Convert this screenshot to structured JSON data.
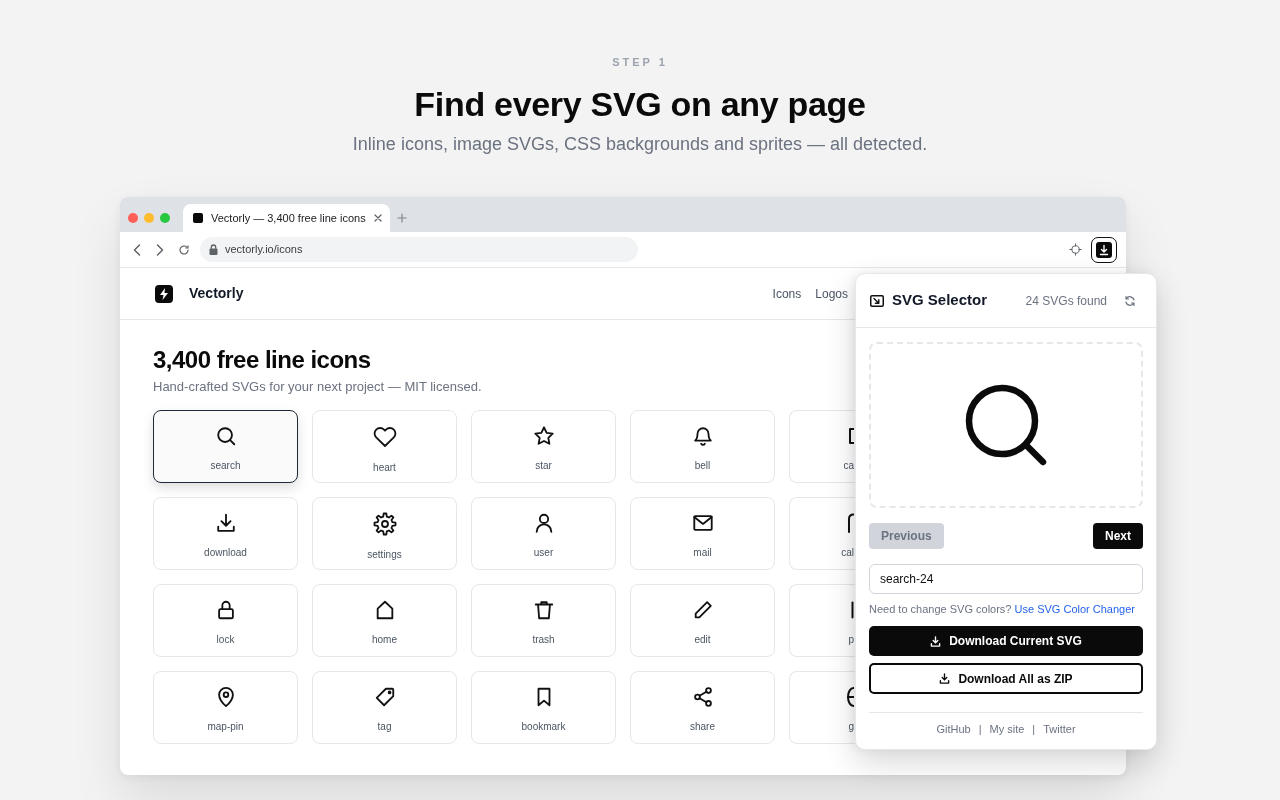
{
  "intro": {
    "step": "STEP 1",
    "title": "Find every SVG on any page",
    "subtitle": "Inline icons, image SVGs, CSS backgrounds and sprites — all detected."
  },
  "browser": {
    "tab": {
      "title": "Vectorly — 3,400 free line icons"
    },
    "address": "vectorly.io/icons",
    "extension_active": true
  },
  "site": {
    "brand": "Vectorly",
    "nav": [
      "Icons",
      "Logos"
    ],
    "title": "3,400 free line icons",
    "subtitle": "Hand-crafted SVGs for your next project — MIT licensed.",
    "icons": [
      {
        "kind": "full",
        "label": "search",
        "selected": true
      },
      {
        "kind": "full",
        "label": "heart",
        "selected": false
      },
      {
        "kind": "full",
        "label": "star",
        "selected": false
      },
      {
        "kind": "full",
        "label": "bell",
        "selected": false
      },
      {
        "kind": "cropped",
        "label": "ca",
        "selected": false
      },
      {
        "kind": "full",
        "label": "download",
        "selected": false
      },
      {
        "kind": "full",
        "label": "settings",
        "selected": false
      },
      {
        "kind": "full",
        "label": "user",
        "selected": false
      },
      {
        "kind": "full",
        "label": "mail",
        "selected": false
      },
      {
        "kind": "cropped",
        "label": "cal",
        "selected": false
      },
      {
        "kind": "full",
        "label": "lock",
        "selected": false
      },
      {
        "kind": "full",
        "label": "home",
        "selected": false
      },
      {
        "kind": "full",
        "label": "trash",
        "selected": false
      },
      {
        "kind": "full",
        "label": "edit",
        "selected": false
      },
      {
        "kind": "cropped",
        "label": "p",
        "selected": false
      },
      {
        "kind": "full",
        "label": "map-pin",
        "selected": false
      },
      {
        "kind": "full",
        "label": "tag",
        "selected": false
      },
      {
        "kind": "full",
        "label": "bookmark",
        "selected": false
      },
      {
        "kind": "full",
        "label": "share",
        "selected": false
      },
      {
        "kind": "cropped",
        "label": "g",
        "selected": false
      }
    ]
  },
  "popup": {
    "title": "SVG Selector",
    "count": "24 SVGs found",
    "buttons": [
      {
        "label": "Previous",
        "disabled": true
      },
      {
        "label": "Next",
        "disabled": false
      }
    ],
    "filename": {
      "value": "search-24"
    },
    "hint": {
      "text": "Need to change SVG colors?",
      "link": "Use SVG Color Changer"
    },
    "actions": [
      {
        "kind": "primary",
        "label": "Download Current SVG"
      },
      {
        "kind": "outline",
        "label": "Download All as ZIP"
      }
    ],
    "footer": {
      "links": [
        "GitHub",
        "My site",
        "Twitter"
      ],
      "separators": [
        "|",
        "|"
      ]
    }
  }
}
